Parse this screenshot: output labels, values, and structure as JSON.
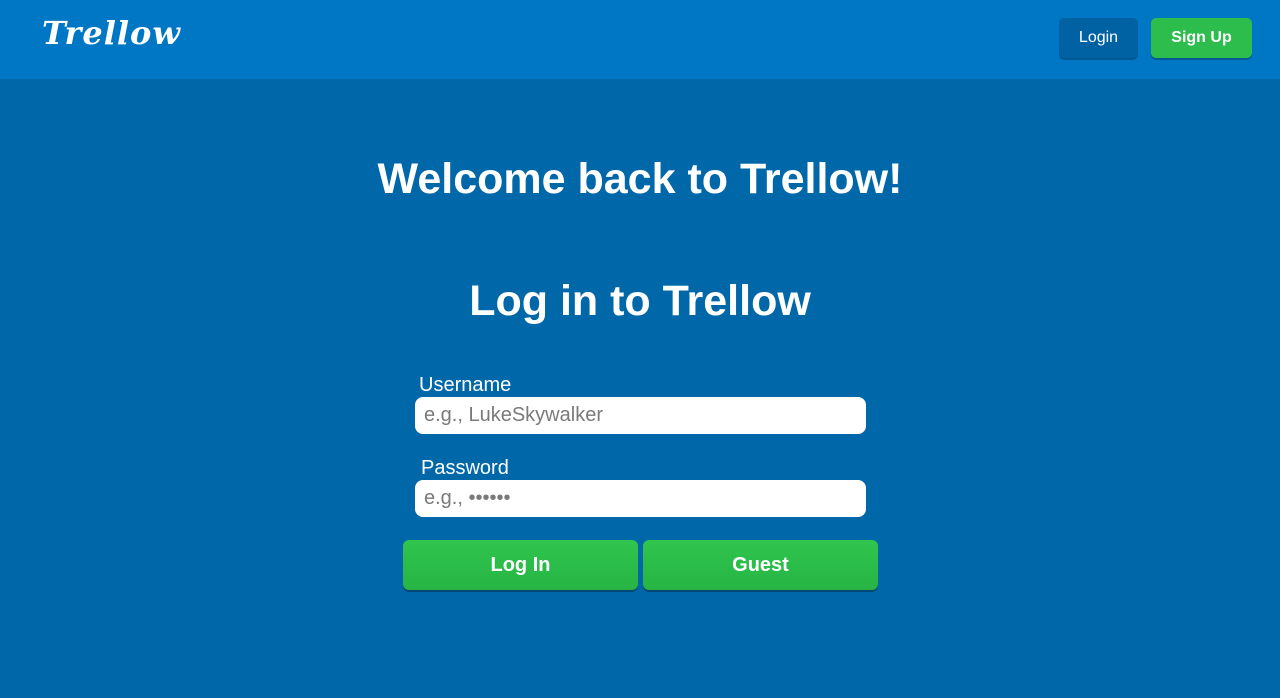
{
  "header": {
    "logo": "Trellow",
    "login_label": "Login",
    "signup_label": "Sign Up"
  },
  "main": {
    "welcome": "Welcome back to Trellow!",
    "form_title": "Log in to Trellow",
    "username_label": "Username",
    "username_placeholder": "e.g., LukeSkywalker",
    "username_value": "",
    "password_label": "Password",
    "password_placeholder": "e.g., ••••••",
    "password_value": "",
    "login_button": "Log In",
    "guest_button": "Guest"
  },
  "colors": {
    "background": "#0067a9",
    "header": "#0077c5",
    "accent_green": "#2dbd4c",
    "nav_login": "#0061a3"
  }
}
